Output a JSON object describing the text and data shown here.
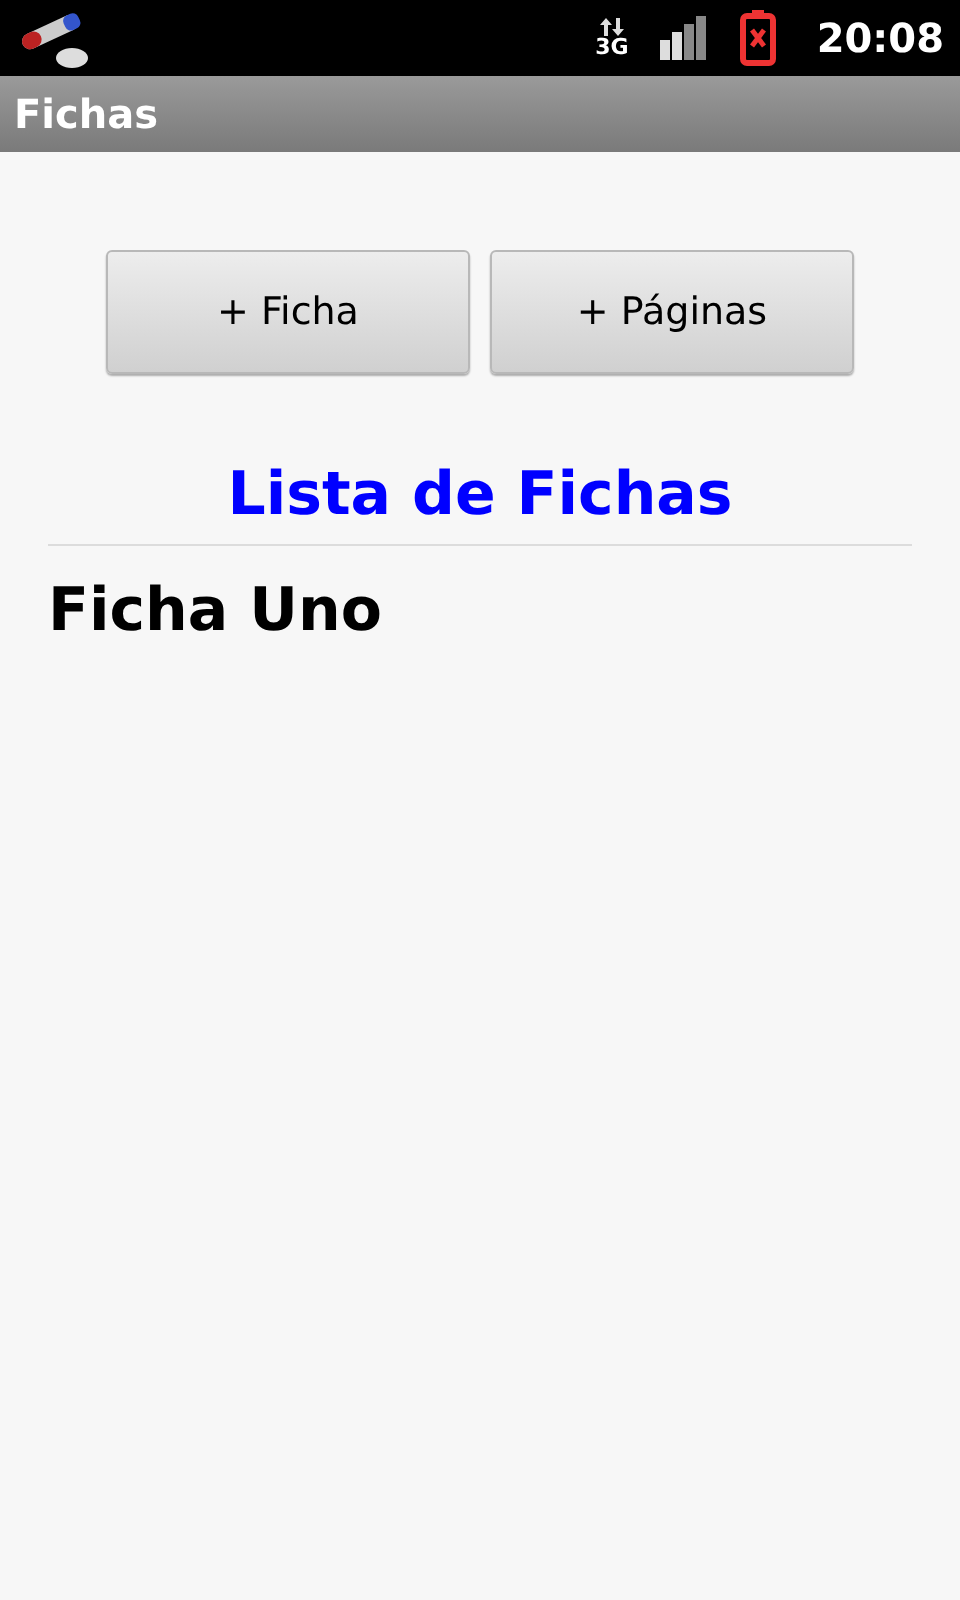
{
  "status_bar": {
    "network_type": "3G",
    "time": "20:08"
  },
  "window": {
    "title": "Fichas"
  },
  "buttons": [
    "+ Ficha",
    "+ Páginas"
  ],
  "list": {
    "title": "Lista de Fichas",
    "items": [
      "Ficha Uno"
    ]
  }
}
